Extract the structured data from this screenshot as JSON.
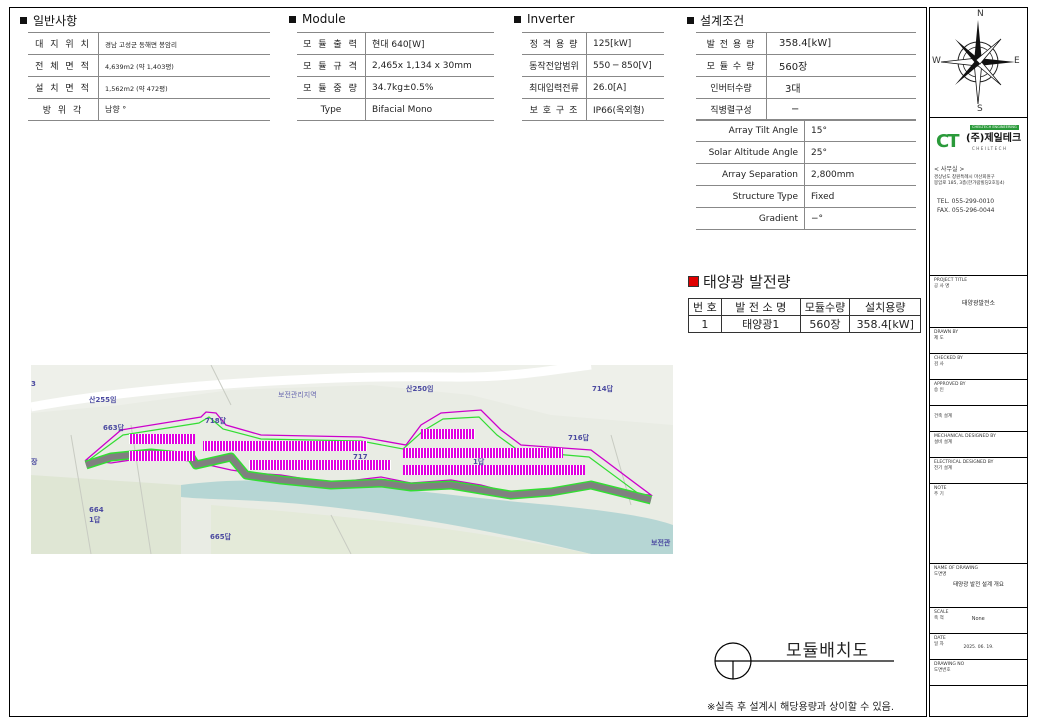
{
  "general": {
    "title": "일반사항",
    "rows": [
      {
        "label": "대 지 위 치",
        "value": "경남 고성군 동해면 봉암리"
      },
      {
        "label": "전 체 면 적",
        "value": "4,639m2 (약 1,403평)"
      },
      {
        "label": "설 치 면 적",
        "value": "1,562m2 (약 472평)"
      },
      {
        "label": "방 위 각",
        "value": "남향 °"
      }
    ]
  },
  "module": {
    "title": "Module",
    "rows": [
      {
        "label": "모 듈 출 력",
        "value": "현대 640[W]"
      },
      {
        "label": "모 듈 규 격",
        "value": "2,465x 1,134 x 30mm"
      },
      {
        "label": "모 듈 중 량",
        "value": "34.7kg±0.5%"
      },
      {
        "label": "Type",
        "value": "Bifacial Mono"
      }
    ]
  },
  "inverter": {
    "title": "Inverter",
    "rows": [
      {
        "label": "정 격 용 량",
        "value": "125[kW]"
      },
      {
        "label": "동작전압범위",
        "value": "550 ─ 850[V]"
      },
      {
        "label": "최대입력전류",
        "value": "26.0[A]"
      },
      {
        "label": "보 호 구 조",
        "value": "IP66(옥외형)"
      }
    ]
  },
  "design": {
    "title": "설계조건",
    "rows": [
      {
        "label": "발 전 용 량",
        "value": "358.4[kW]"
      },
      {
        "label": "모 듈 수 량",
        "value": "560장"
      },
      {
        "label": "인버터수량",
        "value": "3대"
      },
      {
        "label": "직병렬구성",
        "value": "−"
      }
    ],
    "conditions": [
      {
        "label": "Array Tilt Angle",
        "value": "15°"
      },
      {
        "label": "Solar Altitude Angle",
        "value": "25°"
      },
      {
        "label": "Array Separation",
        "value": "2,800mm"
      },
      {
        "label": "Structure Type",
        "value": "Fixed"
      },
      {
        "label": "Gradient",
        "value": "−°"
      }
    ]
  },
  "generation": {
    "title": "태양광 발전량",
    "headers": [
      "번 호",
      "발 전 소 명",
      "모듈수량",
      "설치용량"
    ],
    "rows": [
      [
        "1",
        "태양광1",
        "560장",
        "358.4[kW]"
      ]
    ]
  },
  "map": {
    "labels": [
      {
        "name": "map-label-san255",
        "text": "산255임"
      },
      {
        "name": "map-label-zone",
        "text": "보전관리지역"
      },
      {
        "name": "map-label-san250",
        "text": "산250임"
      },
      {
        "name": "map-label-714",
        "text": "714답"
      },
      {
        "name": "map-label-663",
        "text": "663답"
      },
      {
        "name": "map-label-718",
        "text": "718답"
      },
      {
        "name": "map-label-716",
        "text": "716답"
      },
      {
        "name": "map-label-717",
        "text": "717"
      },
      {
        "name": "map-label-1dap",
        "text": "1답"
      },
      {
        "name": "map-label-664",
        "text": "664"
      },
      {
        "name": "map-label-664b",
        "text": "1답"
      },
      {
        "name": "map-label-665",
        "text": "665답"
      },
      {
        "name": "map-label-left",
        "text": "3"
      },
      {
        "name": "map-label-left2",
        "text": "장"
      },
      {
        "name": "map-label-right",
        "text": "보전관"
      }
    ]
  },
  "drawing_title": "모듈배치도",
  "note": "※실측 후 설계시 해당용량과 상이할 수 있음.",
  "sidebar": {
    "compass": {
      "n": "N",
      "e": "E",
      "s": "S",
      "w": "W"
    },
    "logo_top": "CHEILTECH ENGINEERING",
    "logo_ct": "CT",
    "logo_name": "(주)제일테크",
    "logo_sub": "CHEILTECH",
    "office_title": "< 사무실 >",
    "office_addr1": "경상남도 창원특례시 마산회원구",
    "office_addr2": "봉암로 185, 3층(한가람빌딩2호동4) ",
    "tel": "TEL. 055-299-0010",
    "fax": "FAX. 055-296-0044",
    "project_title_label": "PROJECT TITLE",
    "project_title_ko": "공 사 명",
    "project_title_value": "태양광발전소",
    "drawn_by_label": "DRAWN BY",
    "drawn_by_ko": "제 도",
    "checked_by_label": "CHECKED BY",
    "checked_by_ko": "검 사",
    "approved_by_label": "APPROVED BY",
    "approved_by_ko": "승 인",
    "arch_ko": "건축 설계",
    "mech_label": "MECHANICAL DESIGNED BY",
    "mech_ko": "설비 설계",
    "elec_label": "ELECTRICAL DESIGNED BY",
    "elec_ko": "전기 설계",
    "note_label": "NOTE",
    "note_ko": "주 기",
    "name_label": "NAME OF DRAWING",
    "name_ko": "도면명",
    "name_value": "태양광 발전 설계 개요",
    "scale_label": "SCALE",
    "scale_ko": "축 척",
    "scale_value": "None",
    "date_label": "DATE",
    "date_ko": "일 자",
    "date_value": "2025. 06. 19.",
    "dwgno_label": "DRAWING NO",
    "dwgno_ko": "도면번호"
  },
  "colors": {
    "panel": "#e000e0",
    "boundary": "#cc00cc",
    "inner_boundary": "#33dd33",
    "fence": "#808080",
    "map_bg": "#e9ece4",
    "logo_green": "#2a9a3a"
  }
}
